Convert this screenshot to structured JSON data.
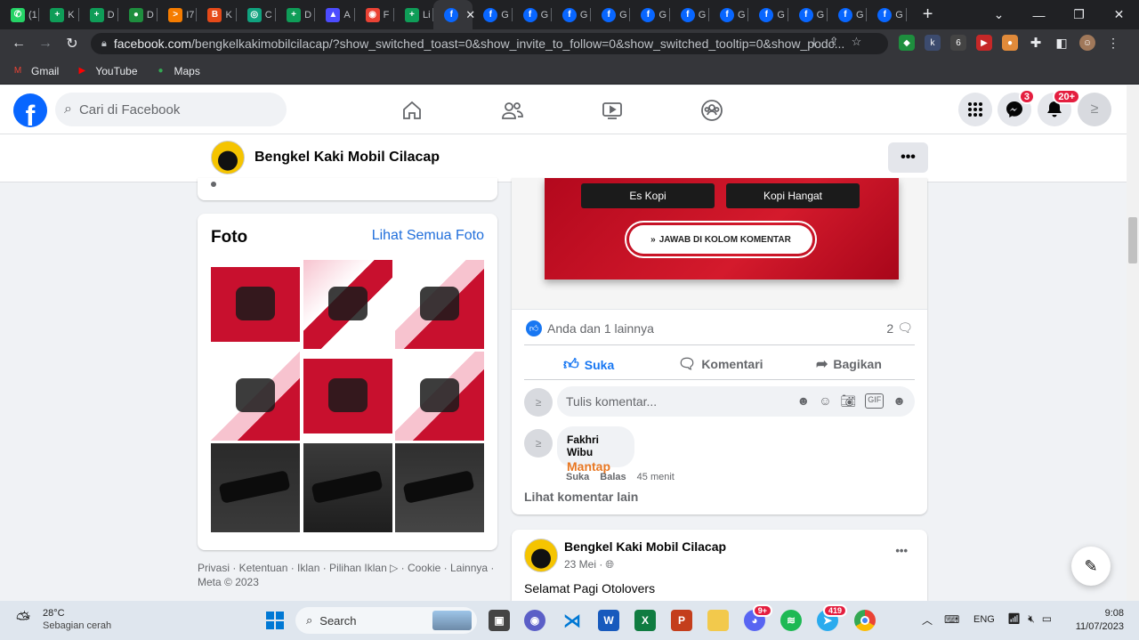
{
  "browser": {
    "tabs": [
      {
        "label": "(1",
        "icon": "whatsapp-icon",
        "color": "#25d366",
        "glyph": "✆"
      },
      {
        "label": "K",
        "icon": "sheets-icon",
        "color": "#0f9d58",
        "glyph": "+"
      },
      {
        "label": "D",
        "icon": "sheets-icon",
        "color": "#0f9d58",
        "glyph": "+"
      },
      {
        "label": "D",
        "icon": "dot-icon",
        "color": "#1e8e3e",
        "glyph": "●"
      },
      {
        "label": "I7",
        "icon": "share-icon",
        "color": "#f57c00",
        "glyph": ">"
      },
      {
        "label": "K",
        "icon": "blogger-icon",
        "color": "#e64a19",
        "glyph": "B"
      },
      {
        "label": "C",
        "icon": "chatgpt-icon",
        "color": "#10a37f",
        "glyph": "◎"
      },
      {
        "label": "D",
        "icon": "sheets-icon",
        "color": "#0f9d58",
        "glyph": "+"
      },
      {
        "label": "A",
        "icon": "drive-icon",
        "color": "#4c4cff",
        "glyph": "▲"
      },
      {
        "label": "F",
        "icon": "photos-icon",
        "color": "#ea4335",
        "glyph": "◉"
      },
      {
        "label": "Li",
        "icon": "sheets-icon",
        "color": "#0f9d58",
        "glyph": "+"
      },
      {
        "label": "",
        "icon": "facebook-icon",
        "color": "#0866ff",
        "glyph": "f",
        "active": true
      },
      {
        "label": "G",
        "icon": "facebook-icon",
        "color": "#0866ff",
        "glyph": "f"
      },
      {
        "label": "G",
        "icon": "facebook-icon",
        "color": "#0866ff",
        "glyph": "f"
      },
      {
        "label": "G",
        "icon": "facebook-icon",
        "color": "#0866ff",
        "glyph": "f"
      },
      {
        "label": "G",
        "icon": "facebook-icon",
        "color": "#0866ff",
        "glyph": "f"
      },
      {
        "label": "G",
        "icon": "facebook-icon",
        "color": "#0866ff",
        "glyph": "f"
      },
      {
        "label": "G",
        "icon": "facebook-icon",
        "color": "#0866ff",
        "glyph": "f"
      },
      {
        "label": "G",
        "icon": "facebook-icon",
        "color": "#0866ff",
        "glyph": "f"
      },
      {
        "label": "G",
        "icon": "facebook-icon",
        "color": "#0866ff",
        "glyph": "f"
      },
      {
        "label": "G",
        "icon": "facebook-icon",
        "color": "#0866ff",
        "glyph": "f"
      },
      {
        "label": "G",
        "icon": "facebook-icon",
        "color": "#0866ff",
        "glyph": "f"
      },
      {
        "label": "G",
        "icon": "facebook-icon",
        "color": "#0866ff",
        "glyph": "f"
      }
    ],
    "url_host": "facebook.com",
    "url_path": "/bengkelkakimobilcilacap/?show_switched_toast=0&show_invite_to_follow=0&show_switched_tooltip=0&show_podc...",
    "bookmarks": [
      {
        "label": "Gmail",
        "icon": "gmail-icon",
        "color": "#ea4335",
        "glyph": "M"
      },
      {
        "label": "YouTube",
        "icon": "youtube-icon",
        "color": "#ff0000",
        "glyph": "▶"
      },
      {
        "label": "Maps",
        "icon": "maps-icon",
        "color": "#34a853",
        "glyph": "●"
      }
    ]
  },
  "fb": {
    "search_placeholder": "Cari di Facebook",
    "messenger_badge": "3",
    "notif_badge": "20+",
    "page_name": "Bengkel Kaki Mobil Cilacap",
    "more": "•••"
  },
  "photos_card": {
    "title": "Foto",
    "see_all": "Lihat Semua Foto"
  },
  "footer": {
    "line1": "Privasi · Ketentuan · Iklan · Pilihan Iklan ▷ · Cookie · Lainnya ·",
    "line2": "Meta © 2023"
  },
  "post": {
    "option1": "Es Kopi",
    "option2": "Kopi Hangat",
    "cta": "JAWAB DI KOLOM KOMENTAR",
    "reactions": "Anda dan 1 lainnya",
    "comment_count": "2",
    "like": "Suka",
    "comment": "Komentari",
    "share": "Bagikan",
    "comment_placeholder": "Tulis komentar...",
    "commenter": "Fakhri Wibu",
    "comment_text": "Mantap",
    "c_like": "Suka",
    "c_reply": "Balas",
    "c_time": "45 menit",
    "more_comments": "Lihat komentar lain"
  },
  "post2": {
    "author": "Bengkel Kaki Mobil Cilacap",
    "date": "23 Mei ·",
    "text": "Selamat Pagi Otolovers",
    "more": "•••"
  },
  "taskbar": {
    "temp": "28°C",
    "weather": "Sebagian cerah",
    "search": "Search",
    "lang": "ENG",
    "time": "9:08",
    "date": "11/07/2023",
    "discord_badge": "9+",
    "telegram_badge": "419"
  },
  "colors": {
    "fb_blue": "#0866ff",
    "comment_orange": "#e87722",
    "promo_red": "#c8102e"
  }
}
